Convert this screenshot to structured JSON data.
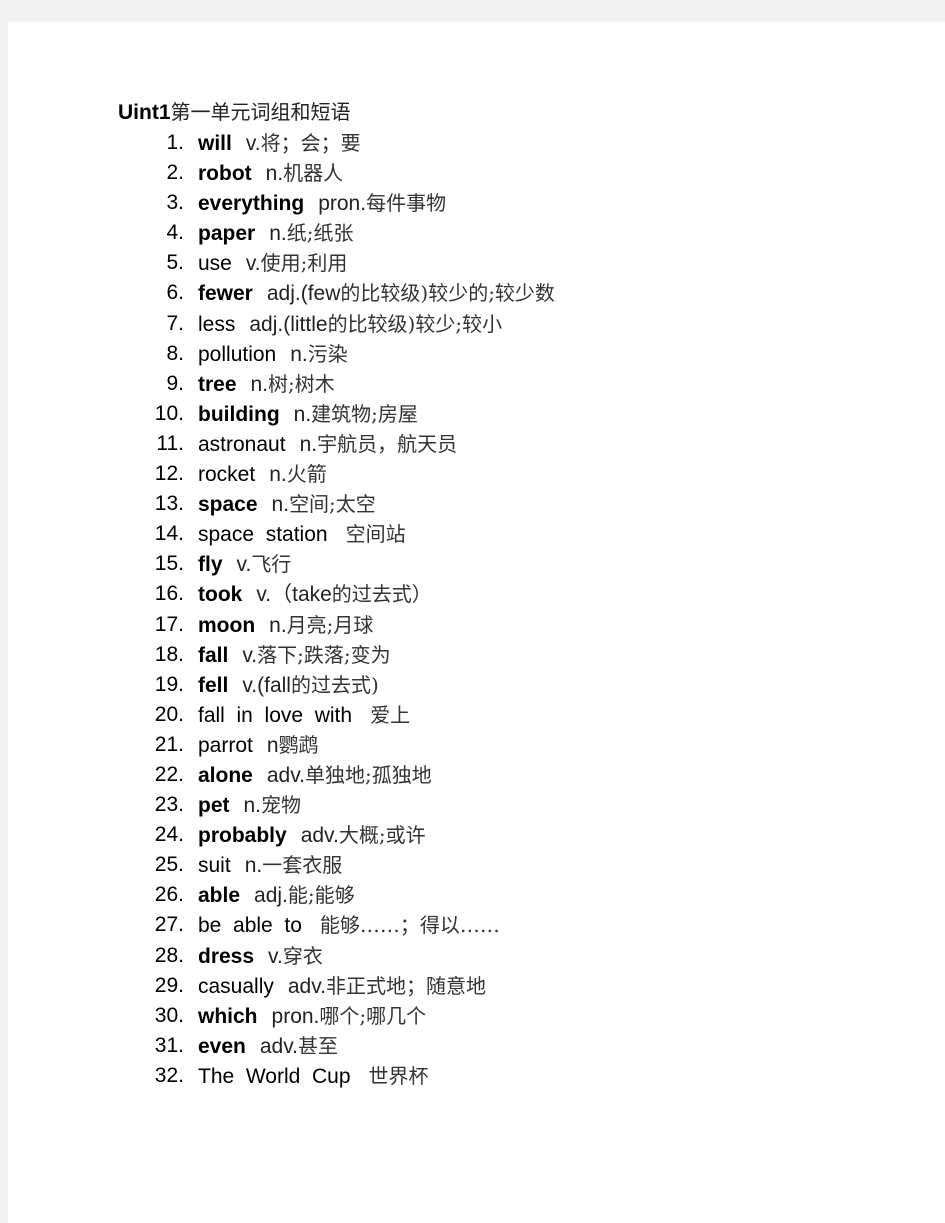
{
  "document": {
    "title_en": "Uint1",
    "title_zh": "第一单元词组和短语",
    "items": [
      {
        "num": "1.",
        "term": "will",
        "bold": true,
        "pos": "v.",
        "meaning": "将；会；要"
      },
      {
        "num": "2.",
        "term": "robot",
        "bold": true,
        "pos": "n.",
        "meaning": "机器人"
      },
      {
        "num": "3.",
        "term": "everything",
        "bold": true,
        "pos": "pron.",
        "meaning": "每件事物"
      },
      {
        "num": "4.",
        "term": "paper",
        "bold": true,
        "pos": "n.",
        "meaning": "纸;纸张"
      },
      {
        "num": "5.",
        "term": "use",
        "bold": false,
        "pos": "v.",
        "meaning": "使用;利用"
      },
      {
        "num": "6.",
        "term": "fewer",
        "bold": true,
        "pos": "adj.(few",
        "meaning": "的比较级)较少的;较少数"
      },
      {
        "num": "7.",
        "term": "less",
        "bold": false,
        "pos": "adj.(little",
        "meaning": "的比较级)较少;较小"
      },
      {
        "num": "8.",
        "term": "pollution",
        "bold": false,
        "pos": "n.",
        "meaning": "污染"
      },
      {
        "num": "9.",
        "term": "tree",
        "bold": true,
        "pos": "n.",
        "meaning": "树;树木"
      },
      {
        "num": "10.",
        "term": "building",
        "bold": true,
        "pos": "n.",
        "meaning": "建筑物;房屋"
      },
      {
        "num": "11.",
        "term": "astronaut",
        "bold": false,
        "pos": "n.",
        "meaning": "宇航员，航天员"
      },
      {
        "num": "12.",
        "term": "rocket",
        "bold": false,
        "pos": "n.",
        "meaning": "火箭"
      },
      {
        "num": "13.",
        "term": "space",
        "bold": true,
        "pos": "n.",
        "meaning": "空间;太空"
      },
      {
        "num": "14.",
        "term": "space  station",
        "bold": false,
        "pos": "",
        "meaning": "空间站"
      },
      {
        "num": "15.",
        "term": "fly",
        "bold": true,
        "pos": "v.",
        "meaning": "飞行"
      },
      {
        "num": "16.",
        "term": "took",
        "bold": true,
        "pos": "v.（take",
        "meaning": "的过去式）"
      },
      {
        "num": "17.",
        "term": "moon",
        "bold": true,
        "pos": "n.",
        "meaning": "月亮;月球"
      },
      {
        "num": "18.",
        "term": "fall",
        "bold": true,
        "pos": "v.",
        "meaning": "落下;跌落;变为"
      },
      {
        "num": "19.",
        "term": "fell",
        "bold": true,
        "pos": "v.(fall",
        "meaning": "的过去式)"
      },
      {
        "num": "20.",
        "term": "fall  in  love  with",
        "bold": false,
        "pos": "",
        "meaning": "爱上"
      },
      {
        "num": "21.",
        "term": "parrot",
        "bold": false,
        "pos": "n",
        "meaning": "鹦鹉"
      },
      {
        "num": "22.",
        "term": "alone",
        "bold": true,
        "pos": "adv.",
        "meaning": "单独地;孤独地"
      },
      {
        "num": "23.",
        "term": "pet",
        "bold": true,
        "pos": "n.",
        "meaning": "宠物"
      },
      {
        "num": "24.",
        "term": "probably",
        "bold": true,
        "pos": "adv.",
        "meaning": "大概;或许"
      },
      {
        "num": "25.",
        "term": "suit",
        "bold": false,
        "pos": "n.",
        "meaning": "一套衣服"
      },
      {
        "num": "26.",
        "term": "able",
        "bold": true,
        "pos": "adj.",
        "meaning": "能;能够"
      },
      {
        "num": "27.",
        "term": "be  able  to",
        "bold": false,
        "pos": "",
        "meaning": "能够……；得以……"
      },
      {
        "num": "28.",
        "term": "dress",
        "bold": true,
        "pos": "v.",
        "meaning": "穿衣"
      },
      {
        "num": "29.",
        "term": "casually",
        "bold": false,
        "pos": "adv.",
        "meaning": "非正式地；随意地"
      },
      {
        "num": "30.",
        "term": "which",
        "bold": true,
        "pos": "pron.",
        "meaning": "哪个;哪几个"
      },
      {
        "num": "31.",
        "term": "even",
        "bold": true,
        "pos": "adv.",
        "meaning": "甚至"
      },
      {
        "num": "32.",
        "term": "The  World  Cup",
        "bold": false,
        "pos": "",
        "meaning": "世界杯"
      }
    ]
  }
}
